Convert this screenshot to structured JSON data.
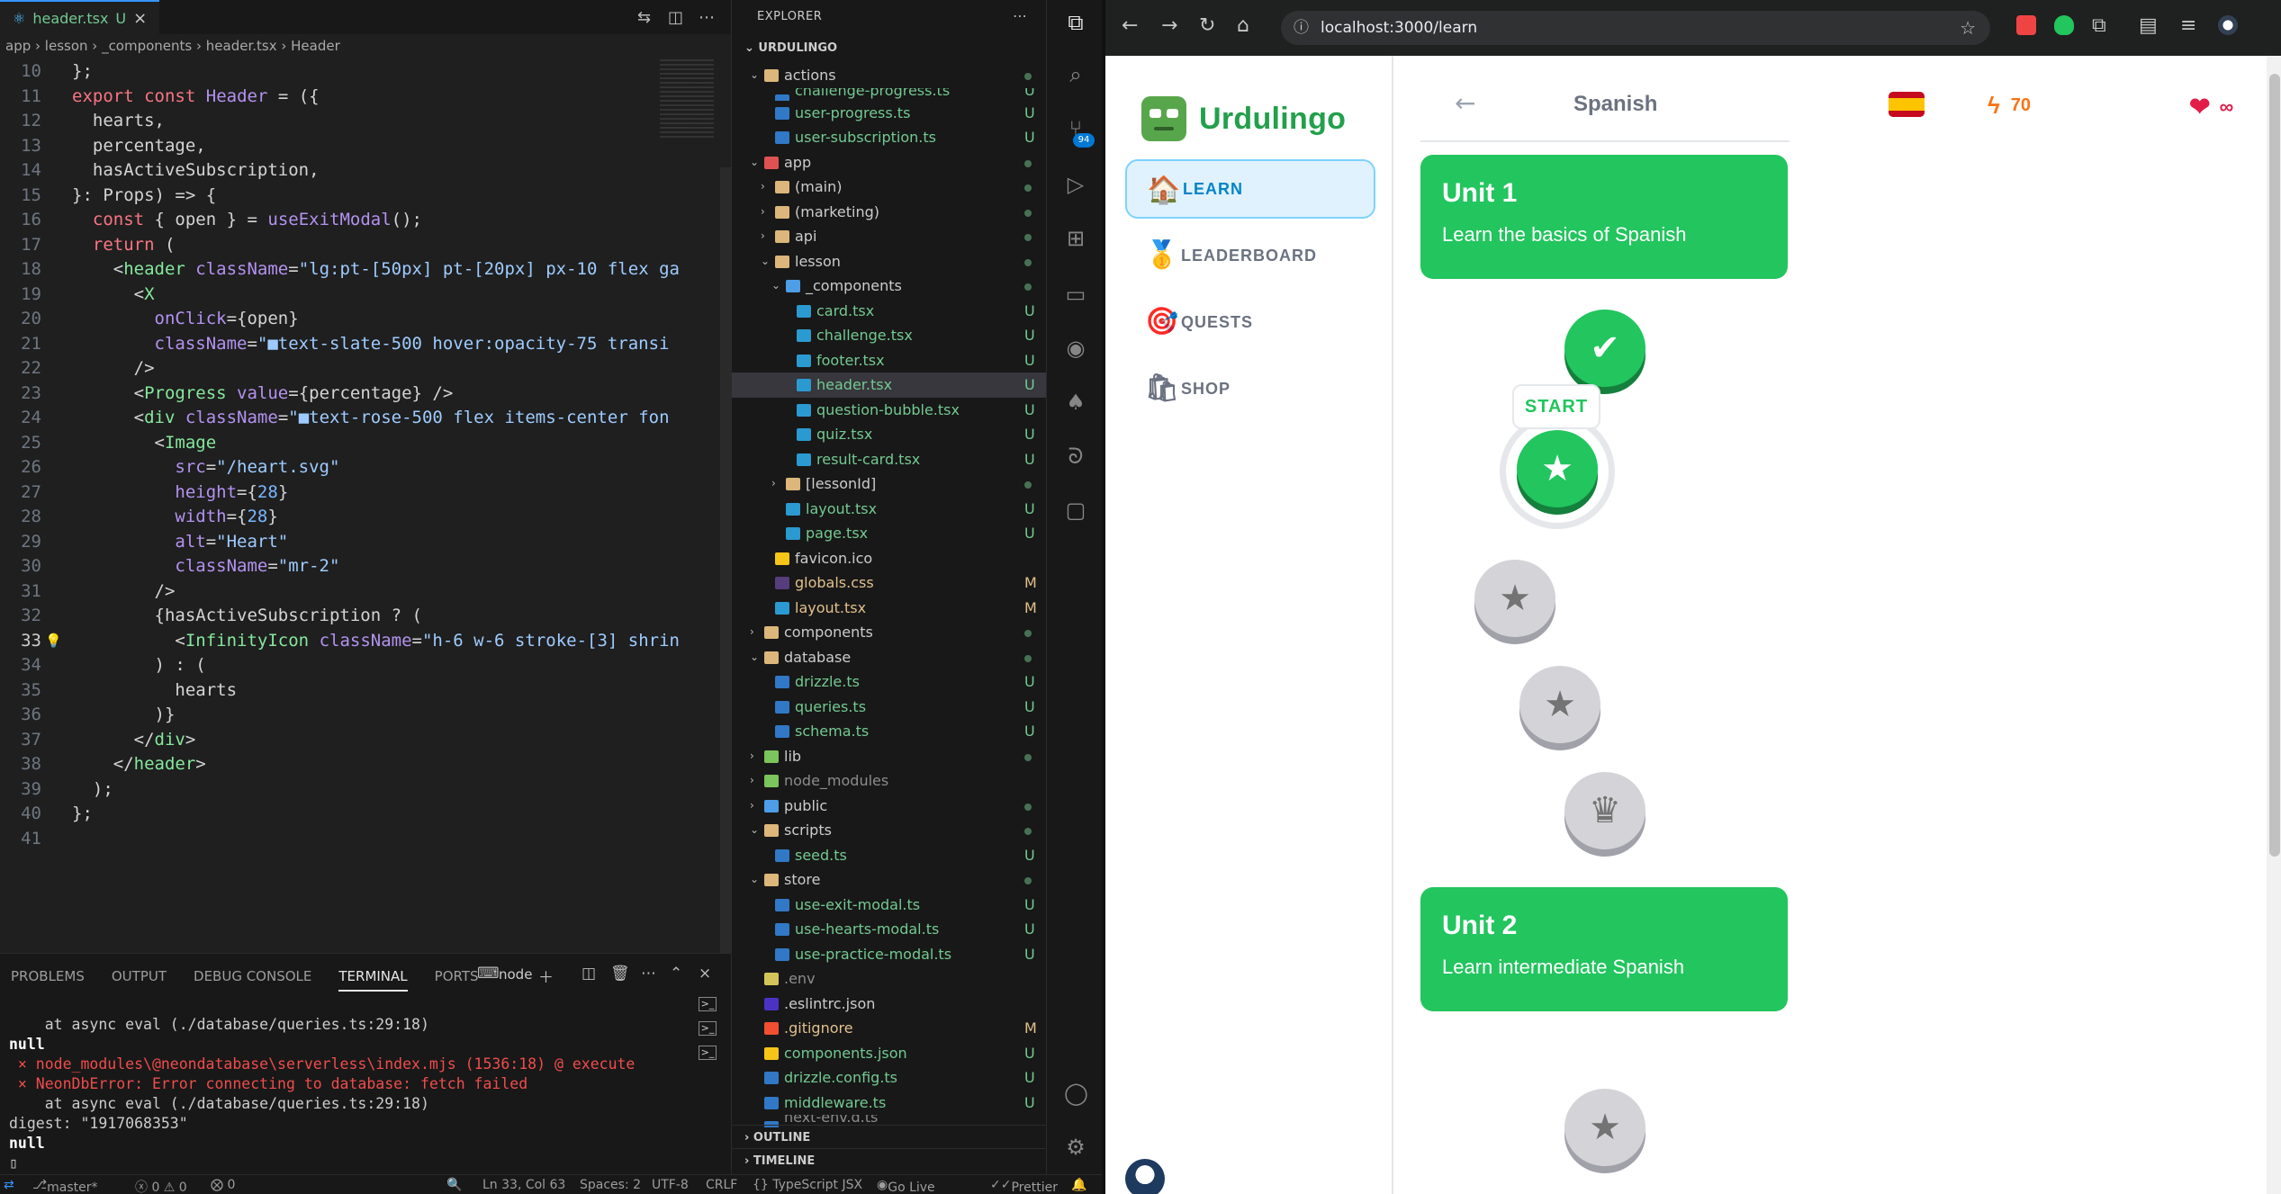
{
  "editor": {
    "tab_label": "header.tsx",
    "tab_status": "U",
    "breadcrumb": [
      "app",
      "lesson",
      "_components",
      "header.tsx",
      "Header"
    ],
    "lines": [
      {
        "n": "10",
        "t": "};"
      },
      {
        "n": "11",
        "t": "export const Header = ({"
      },
      {
        "n": "12",
        "t": "  hearts,"
      },
      {
        "n": "13",
        "t": "  percentage,"
      },
      {
        "n": "14",
        "t": "  hasActiveSubscription,"
      },
      {
        "n": "15",
        "t": "}: Props) => {"
      },
      {
        "n": "16",
        "t": "  const { open } = useExitModal();"
      },
      {
        "n": "17",
        "t": "  return ("
      },
      {
        "n": "18",
        "t": "    <header className=\"lg:pt-[50px] pt-[20px] px-10 flex ga"
      },
      {
        "n": "19",
        "t": "      <X"
      },
      {
        "n": "20",
        "t": "        onClick={open}"
      },
      {
        "n": "21",
        "t": "        className=\"■text-slate-500 hover:opacity-75 transi"
      },
      {
        "n": "22",
        "t": "      />"
      },
      {
        "n": "23",
        "t": "      <Progress value={percentage} />"
      },
      {
        "n": "24",
        "t": "      <div className=\"■text-rose-500 flex items-center fon"
      },
      {
        "n": "25",
        "t": "        <Image"
      },
      {
        "n": "26",
        "t": "          src=\"/heart.svg\""
      },
      {
        "n": "27",
        "t": "          height={28}"
      },
      {
        "n": "28",
        "t": "          width={28}"
      },
      {
        "n": "29",
        "t": "          alt=\"Heart\""
      },
      {
        "n": "30",
        "t": "          className=\"mr-2\""
      },
      {
        "n": "31",
        "t": "        />"
      },
      {
        "n": "32",
        "t": "        {hasActiveSubscription ? ("
      },
      {
        "n": "33",
        "t": "          <InfinityIcon className=\"h-6 w-6 stroke-[3] shrin"
      },
      {
        "n": "34",
        "t": "        ) : ("
      },
      {
        "n": "35",
        "t": "          hearts"
      },
      {
        "n": "36",
        "t": "        )}"
      },
      {
        "n": "37",
        "t": "      </div>"
      },
      {
        "n": "38",
        "t": "    </header>"
      },
      {
        "n": "39",
        "t": "  );"
      },
      {
        "n": "40",
        "t": "};"
      },
      {
        "n": "41",
        "t": ""
      }
    ]
  },
  "panel": {
    "tabs": [
      "PROBLEMS",
      "OUTPUT",
      "DEBUG CONSOLE",
      "TERMINAL",
      "PORTS"
    ],
    "active_tab": "TERMINAL",
    "terminal_name": "node",
    "lines": [
      "    at async eval (./database/queries.ts:29:18)",
      "null",
      " × node_modules\\@neondatabase\\serverless\\index.mjs (1536:18) @ execute",
      " × NeonDbError: Error connecting to database: fetch failed",
      "    at async eval (./database/queries.ts:29:18)",
      "digest: \"1917068353\"",
      "null"
    ]
  },
  "status": {
    "branch": "master*",
    "errors": "ⓧ 0 ⚠ 0",
    "ports": "⨂ 0",
    "position": "Ln 33, Col 63",
    "spaces": "Spaces: 2",
    "encoding": "UTF-8",
    "eol": "CRLF",
    "language": "{} TypeScript JSX",
    "golive": "Go Live",
    "prettier": "Prettier"
  },
  "explorer": {
    "title": "EXPLORER",
    "root": "URDULINGO",
    "rows": [
      {
        "d": 1,
        "k": "folder",
        "c": "fold",
        "l": "actions",
        "s": "dot",
        "open": true
      },
      {
        "d": 2,
        "k": "ts",
        "l": "challenge-progress.ts",
        "s": "U",
        "cut": true
      },
      {
        "d": 2,
        "k": "ts",
        "l": "user-progress.ts",
        "s": "U"
      },
      {
        "d": 2,
        "k": "ts",
        "l": "user-subscription.ts",
        "s": "U"
      },
      {
        "d": 1,
        "k": "folder",
        "c": "folder-red",
        "l": "app",
        "s": "dot",
        "open": true
      },
      {
        "d": 2,
        "k": "folder",
        "c": "fold",
        "l": "(main)",
        "s": "dot"
      },
      {
        "d": 2,
        "k": "folder",
        "c": "fold",
        "l": "(marketing)",
        "s": "dot"
      },
      {
        "d": 2,
        "k": "folder",
        "c": "fold",
        "l": "api",
        "s": "dot"
      },
      {
        "d": 2,
        "k": "folder",
        "c": "fold",
        "l": "lesson",
        "s": "dot",
        "open": true
      },
      {
        "d": 3,
        "k": "folder",
        "c": "folder-blue",
        "l": "_components",
        "s": "dot",
        "open": true
      },
      {
        "d": 4,
        "k": "tsx",
        "l": "card.tsx",
        "s": "U"
      },
      {
        "d": 4,
        "k": "tsx",
        "l": "challenge.tsx",
        "s": "U"
      },
      {
        "d": 4,
        "k": "tsx",
        "l": "footer.tsx",
        "s": "U"
      },
      {
        "d": 4,
        "k": "tsx",
        "l": "header.tsx",
        "s": "U",
        "sel": true
      },
      {
        "d": 4,
        "k": "tsx",
        "l": "question-bubble.tsx",
        "s": "U"
      },
      {
        "d": 4,
        "k": "tsx",
        "l": "quiz.tsx",
        "s": "U"
      },
      {
        "d": 4,
        "k": "tsx",
        "l": "result-card.tsx",
        "s": "U"
      },
      {
        "d": 3,
        "k": "folder",
        "c": "fold",
        "l": "[lessonId]",
        "s": "dot"
      },
      {
        "d": 3,
        "k": "tsx",
        "l": "layout.tsx",
        "s": "U"
      },
      {
        "d": 3,
        "k": "tsx",
        "l": "page.tsx",
        "s": "U"
      },
      {
        "d": 2,
        "k": "star",
        "l": "favicon.ico",
        "s": ""
      },
      {
        "d": 2,
        "k": "css",
        "l": "globals.css",
        "s": "M"
      },
      {
        "d": 2,
        "k": "tsx",
        "l": "layout.tsx",
        "s": "M"
      },
      {
        "d": 1,
        "k": "folder",
        "c": "fold",
        "l": "components",
        "s": "dot"
      },
      {
        "d": 1,
        "k": "folder",
        "c": "fold",
        "l": "database",
        "s": "dot",
        "open": true
      },
      {
        "d": 2,
        "k": "ts",
        "l": "drizzle.ts",
        "s": "U"
      },
      {
        "d": 2,
        "k": "ts",
        "l": "queries.ts",
        "s": "U"
      },
      {
        "d": 2,
        "k": "ts",
        "l": "schema.ts",
        "s": "U"
      },
      {
        "d": 1,
        "k": "folder",
        "c": "folder-green",
        "l": "lib",
        "s": "dot"
      },
      {
        "d": 1,
        "k": "folder",
        "c": "folder-green",
        "l": "node_modules",
        "s": "",
        "dim": true
      },
      {
        "d": 1,
        "k": "folder",
        "c": "folder-blue",
        "l": "public",
        "s": "dot"
      },
      {
        "d": 1,
        "k": "folder",
        "c": "fold",
        "l": "scripts",
        "s": "dot",
        "open": true
      },
      {
        "d": 2,
        "k": "ts",
        "l": "seed.ts",
        "s": "U"
      },
      {
        "d": 1,
        "k": "folder",
        "c": "fold",
        "l": "store",
        "s": "dot",
        "open": true
      },
      {
        "d": 2,
        "k": "ts",
        "l": "use-exit-modal.ts",
        "s": "U"
      },
      {
        "d": 2,
        "k": "ts",
        "l": "use-hearts-modal.ts",
        "s": "U"
      },
      {
        "d": 2,
        "k": "ts",
        "l": "use-practice-modal.ts",
        "s": "U"
      },
      {
        "d": 1,
        "k": "env",
        "l": ".env",
        "s": "",
        "dim": true
      },
      {
        "d": 1,
        "k": "eslint",
        "l": ".eslintrc.json",
        "s": ""
      },
      {
        "d": 1,
        "k": "git",
        "l": ".gitignore",
        "s": "M"
      },
      {
        "d": 1,
        "k": "json",
        "l": "components.json",
        "s": "U"
      },
      {
        "d": 1,
        "k": "ts",
        "l": "drizzle.config.ts",
        "s": "U"
      },
      {
        "d": 1,
        "k": "ts",
        "l": "middleware.ts",
        "s": "U"
      },
      {
        "d": 1,
        "k": "ts",
        "l": "next-env.d.ts",
        "s": "",
        "dim": true,
        "cut": true
      }
    ],
    "outline": "OUTLINE",
    "timeline": "TIMELINE"
  },
  "activity": {
    "badge": "94"
  },
  "browser": {
    "url": "localhost:3000/learn"
  },
  "app": {
    "name": "Urdulingo",
    "nav": [
      {
        "label": "LEARN",
        "icon": "🏠",
        "active": true
      },
      {
        "label": "LEADERBOARD",
        "icon": "🥇"
      },
      {
        "label": "QUESTS",
        "icon": "🎯"
      },
      {
        "label": "SHOP",
        "icon": "🛍"
      }
    ],
    "header": {
      "title": "Spanish",
      "streak": "70",
      "hearts": "∞"
    },
    "units": [
      {
        "title": "Unit 1",
        "description": "Learn the basics of Spanish"
      },
      {
        "title": "Unit 2",
        "description": "Learn intermediate Spanish"
      }
    ],
    "start_label": "START"
  }
}
